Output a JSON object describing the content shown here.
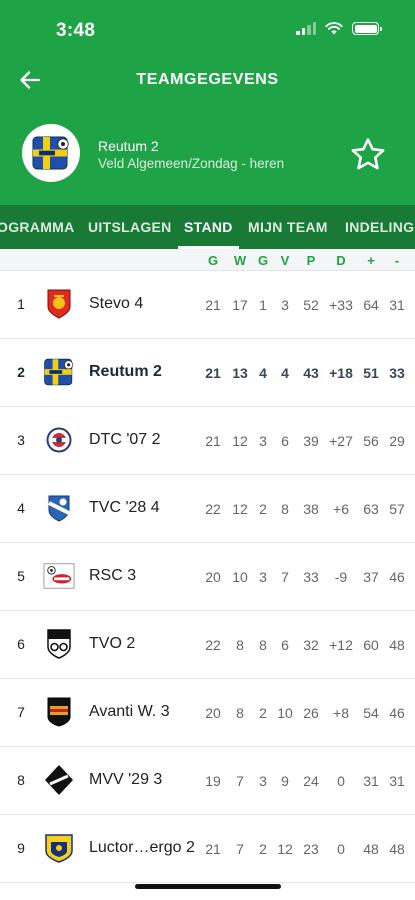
{
  "status_bar": {
    "time": "3:48"
  },
  "header": {
    "title": "TEAMGEGEVENS"
  },
  "team": {
    "name": "Reutum 2",
    "subtitle": "Veld Algemeen/Zondag - heren"
  },
  "tabs": [
    {
      "label": "OGRAMMA",
      "active": false
    },
    {
      "label": "UITSLAGEN",
      "active": false
    },
    {
      "label": "STAND",
      "active": true
    },
    {
      "label": "MIJN TEAM",
      "active": false
    },
    {
      "label": "INDELING",
      "active": false
    }
  ],
  "table": {
    "headers": [
      "G",
      "W",
      "G",
      "V",
      "P",
      "D",
      "+",
      "-"
    ],
    "rows": [
      {
        "pos": "1",
        "club": "Stevo 4",
        "logo": "stevo-logo",
        "stats": [
          "21",
          "17",
          "1",
          "3",
          "52",
          "+33",
          "64",
          "31"
        ]
      },
      {
        "pos": "2",
        "club": "Reutum 2",
        "logo": "reutum-logo",
        "highlight": true,
        "stats": [
          "21",
          "13",
          "4",
          "4",
          "43",
          "+18",
          "51",
          "33"
        ]
      },
      {
        "pos": "3",
        "club": "DTC '07 2",
        "logo": "dtc-logo",
        "stats": [
          "21",
          "12",
          "3",
          "6",
          "39",
          "+27",
          "56",
          "29"
        ]
      },
      {
        "pos": "4",
        "club": "TVC '28 4",
        "logo": "tvc-logo",
        "stats": [
          "22",
          "12",
          "2",
          "8",
          "38",
          "+6",
          "63",
          "57"
        ]
      },
      {
        "pos": "5",
        "club": "RSC 3",
        "logo": "rsc-logo",
        "stats": [
          "20",
          "10",
          "3",
          "7",
          "33",
          "-9",
          "37",
          "46"
        ]
      },
      {
        "pos": "6",
        "club": "TVO 2",
        "logo": "tvo-logo",
        "stats": [
          "22",
          "8",
          "8",
          "6",
          "32",
          "+12",
          "60",
          "48"
        ]
      },
      {
        "pos": "7",
        "club": "Avanti W. 3",
        "logo": "avanti-logo",
        "stats": [
          "20",
          "8",
          "2",
          "10",
          "26",
          "+8",
          "54",
          "46"
        ]
      },
      {
        "pos": "8",
        "club": "MVV '29 3",
        "logo": "mvv-logo",
        "stats": [
          "19",
          "7",
          "3",
          "9",
          "24",
          "0",
          "31",
          "31"
        ]
      },
      {
        "pos": "9",
        "club": "Luctor…ergo 2",
        "logo": "luctor-logo",
        "stats": [
          "21",
          "7",
          "2",
          "12",
          "23",
          "0",
          "48",
          "48"
        ]
      }
    ]
  },
  "colors": {
    "brand_green": "#1fa347",
    "tab_bar_green": "#187a35",
    "highlight_text": "#1d2a3a"
  },
  "icons": {
    "back": "back-arrow-icon",
    "favorite": "star-outline-icon"
  }
}
